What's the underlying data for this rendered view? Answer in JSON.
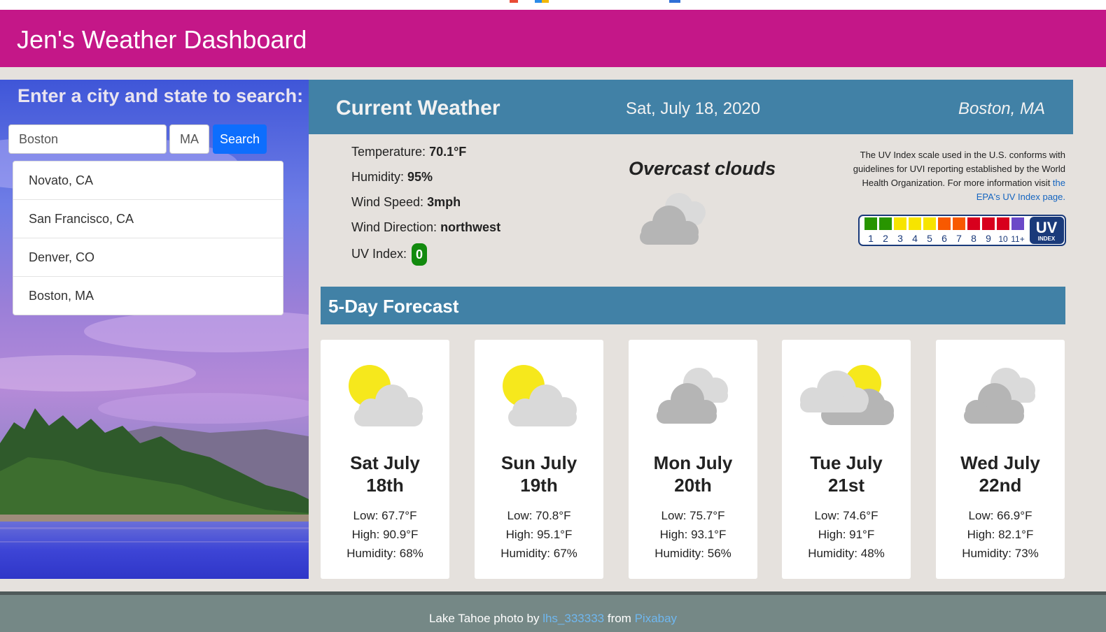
{
  "app": {
    "title": "Jen's Weather Dashboard"
  },
  "search": {
    "heading": "Enter a city and state to search:",
    "city_value": "Boston",
    "state_value": "MA",
    "button_label": "Search",
    "history": [
      "Novato, CA",
      "San Francisco, CA",
      "Denver, CO",
      "Boston, MA"
    ]
  },
  "current": {
    "title": "Current Weather",
    "date": "Sat, July 18, 2020",
    "city": "Boston, MA",
    "description": "Overcast clouds",
    "icon": "overcast-clouds-icon",
    "temperature_label": "Temperature:",
    "temperature": "70.1°F",
    "humidity_label": "Humidity:",
    "humidity": "95%",
    "wind_speed_label": "Wind Speed:",
    "wind_speed": "3mph",
    "wind_direction_label": "Wind Direction:",
    "wind_direction": "northwest",
    "uv_label": "UV Index:",
    "uv_index": "0",
    "uv_color": "#128a0e"
  },
  "uv_info": {
    "text": "The UV Index scale used in the U.S. conforms with guidelines for UVI reporting established by the World Health Organization. For more information visit ",
    "link_text": "the EPA's UV Index page.",
    "scale_numbers": [
      "1",
      "2",
      "3",
      "4",
      "5",
      "6",
      "7",
      "8",
      "9",
      "10",
      "11+"
    ],
    "scale_colors": [
      "#289500",
      "#289500",
      "#f7e400",
      "#f7e400",
      "#f7e400",
      "#f85900",
      "#f85900",
      "#d8001d",
      "#d8001d",
      "#d8001d",
      "#6b49c8"
    ],
    "badge_top": "UV",
    "badge_bottom": "INDEX"
  },
  "forecast": {
    "title": "5-Day Forecast",
    "days": [
      {
        "day_line1": "Sat July",
        "day_line2": "18th",
        "low": "Low: 67.7°F",
        "high": "High: 90.9°F",
        "humidity": "Humidity: 68%",
        "icon": "partly-cloudy-icon"
      },
      {
        "day_line1": "Sun July",
        "day_line2": "19th",
        "low": "Low: 70.8°F",
        "high": "High: 95.1°F",
        "humidity": "Humidity: 67%",
        "icon": "partly-cloudy-icon"
      },
      {
        "day_line1": "Mon July",
        "day_line2": "20th",
        "low": "Low: 75.7°F",
        "high": "High: 93.1°F",
        "humidity": "Humidity: 56%",
        "icon": "overcast-clouds-icon"
      },
      {
        "day_line1": "Tue July",
        "day_line2": "21st",
        "low": "Low: 74.6°F",
        "high": "High: 91°F",
        "humidity": "Humidity: 48%",
        "icon": "mostly-cloudy-icon"
      },
      {
        "day_line1": "Wed July",
        "day_line2": "22nd",
        "low": "Low: 66.9°F",
        "high": "High: 82.1°F",
        "humidity": "Humidity: 73%",
        "icon": "overcast-clouds-icon"
      }
    ]
  },
  "footer": {
    "prefix": "Lake Tahoe photo by ",
    "author": "lhs_333333",
    "middle": " from ",
    "source": "Pixabay"
  }
}
